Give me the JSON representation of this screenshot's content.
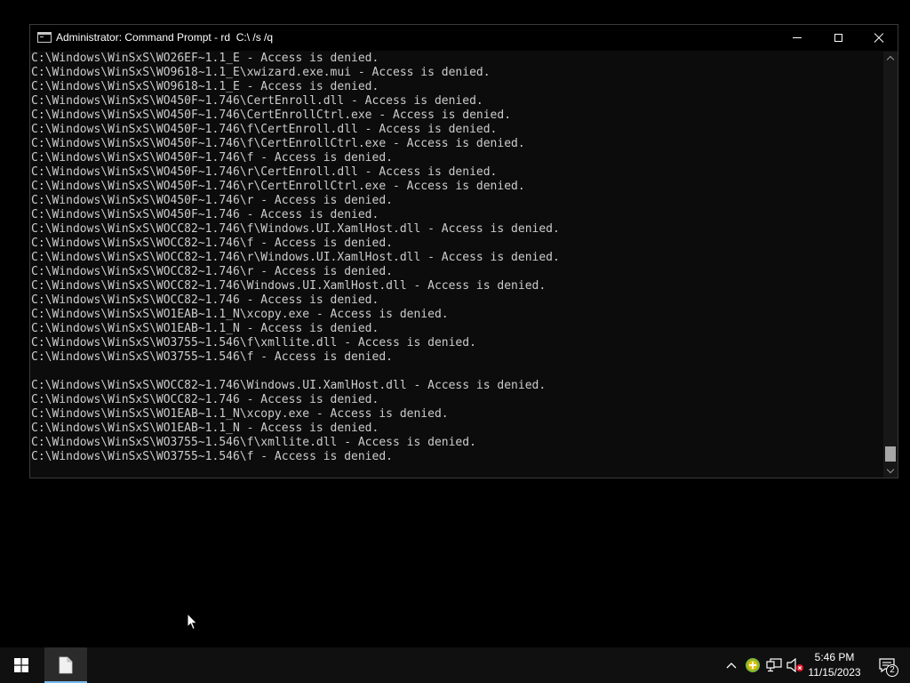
{
  "window": {
    "title": "Administrator: Command Prompt - rd  C:\\ /s /q",
    "minimize_label": "",
    "maximize_label": "",
    "close_label": ""
  },
  "console": {
    "lines": [
      "C:\\Windows\\WinSxS\\WO26EF~1.1_E - Access is denied.",
      "C:\\Windows\\WinSxS\\WO9618~1.1_E\\xwizard.exe.mui - Access is denied.",
      "C:\\Windows\\WinSxS\\WO9618~1.1_E - Access is denied.",
      "C:\\Windows\\WinSxS\\WO450F~1.746\\CertEnroll.dll - Access is denied.",
      "C:\\Windows\\WinSxS\\WO450F~1.746\\CertEnrollCtrl.exe - Access is denied.",
      "C:\\Windows\\WinSxS\\WO450F~1.746\\f\\CertEnroll.dll - Access is denied.",
      "C:\\Windows\\WinSxS\\WO450F~1.746\\f\\CertEnrollCtrl.exe - Access is denied.",
      "C:\\Windows\\WinSxS\\WO450F~1.746\\f - Access is denied.",
      "C:\\Windows\\WinSxS\\WO450F~1.746\\r\\CertEnroll.dll - Access is denied.",
      "C:\\Windows\\WinSxS\\WO450F~1.746\\r\\CertEnrollCtrl.exe - Access is denied.",
      "C:\\Windows\\WinSxS\\WO450F~1.746\\r - Access is denied.",
      "C:\\Windows\\WinSxS\\WO450F~1.746 - Access is denied.",
      "C:\\Windows\\WinSxS\\WOCC82~1.746\\f\\Windows.UI.XamlHost.dll - Access is denied.",
      "C:\\Windows\\WinSxS\\WOCC82~1.746\\f - Access is denied.",
      "C:\\Windows\\WinSxS\\WOCC82~1.746\\r\\Windows.UI.XamlHost.dll - Access is denied.",
      "C:\\Windows\\WinSxS\\WOCC82~1.746\\r - Access is denied.",
      "C:\\Windows\\WinSxS\\WOCC82~1.746\\Windows.UI.XamlHost.dll - Access is denied.",
      "C:\\Windows\\WinSxS\\WOCC82~1.746 - Access is denied.",
      "C:\\Windows\\WinSxS\\WO1EAB~1.1_N\\xcopy.exe - Access is denied.",
      "C:\\Windows\\WinSxS\\WO1EAB~1.1_N - Access is denied.",
      "C:\\Windows\\WinSxS\\WO3755~1.546\\f\\xmllite.dll - Access is denied.",
      "C:\\Windows\\WinSxS\\WO3755~1.546\\f - Access is denied.",
      "",
      "C:\\Windows\\WinSxS\\WOCC82~1.746\\Windows.UI.XamlHost.dll - Access is denied.",
      "C:\\Windows\\WinSxS\\WOCC82~1.746 - Access is denied.",
      "C:\\Windows\\WinSxS\\WO1EAB~1.1_N\\xcopy.exe - Access is denied.",
      "C:\\Windows\\WinSxS\\WO1EAB~1.1_N - Access is denied.",
      "C:\\Windows\\WinSxS\\WO3755~1.546\\f\\xmllite.dll - Access is denied.",
      "C:\\Windows\\WinSxS\\WO3755~1.546\\f - Access is denied."
    ]
  },
  "taskbar": {
    "time": "5:46 PM",
    "date": "11/15/2023",
    "notification_count": "2",
    "icons": {
      "start": "windows-logo-icon",
      "app": "file-icon",
      "tray_chevron": "chevron-up-icon",
      "security": "shield-warning-icon",
      "network": "network-icon",
      "volume": "volume-muted-icon",
      "notifications": "action-center-icon"
    }
  },
  "colors": {
    "console_bg": "#0c0c0c",
    "console_text": "#cccccc",
    "taskbar_bg": "#101010",
    "accent": "#76b9ed",
    "security_badge": "#e0c000",
    "mute_badge": "#e81123"
  }
}
